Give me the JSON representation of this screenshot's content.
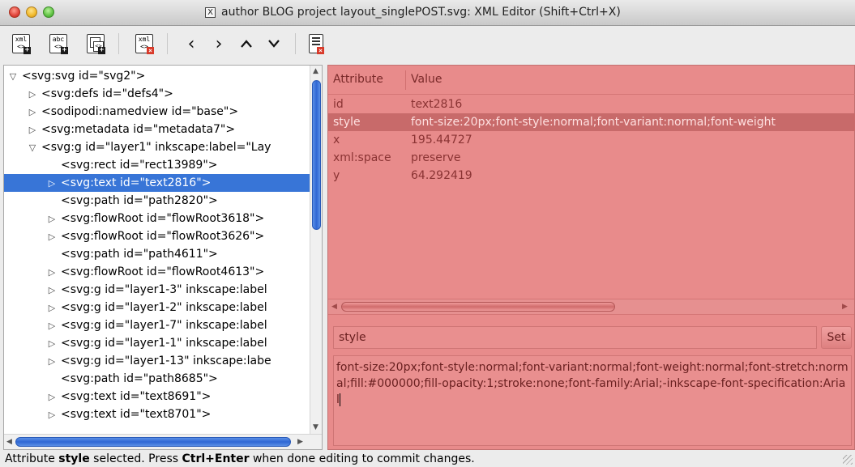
{
  "window": {
    "title": "author BLOG project layout_singlePOST.svg: XML Editor (Shift+Ctrl+X)"
  },
  "toolbar": {
    "buttons": [
      {
        "name": "new-element-node",
        "icon": "xml-new-element-icon",
        "glyph": "xml"
      },
      {
        "name": "new-text-node",
        "icon": "abc-new-text-icon",
        "glyph": "abc"
      },
      {
        "name": "duplicate-node",
        "icon": "duplicate-node-icon",
        "glyph": ""
      },
      {
        "name": "delete-node",
        "icon": "xml-delete-node-icon",
        "glyph": "xml"
      },
      {
        "name": "unindent-node",
        "icon": "chevron-left-icon",
        "glyph": "‹"
      },
      {
        "name": "indent-node",
        "icon": "chevron-right-icon",
        "glyph": "›"
      },
      {
        "name": "raise-node",
        "icon": "chevron-up-icon",
        "glyph": "⌃"
      },
      {
        "name": "lower-node",
        "icon": "chevron-down-icon",
        "glyph": "⌄"
      },
      {
        "name": "delete-attribute",
        "icon": "delete-attribute-icon",
        "glyph": ""
      }
    ]
  },
  "tree": {
    "nodes": [
      {
        "text": "<svg:svg id=\"svg2\">",
        "expander": "▽"
      },
      {
        "text": "<svg:defs id=\"defs4\">",
        "expander": "▷"
      },
      {
        "text": "<sodipodi:namedview id=\"base\">",
        "expander": "▷"
      },
      {
        "text": "<svg:metadata id=\"metadata7\">",
        "expander": "▷"
      },
      {
        "text": "<svg:g id=\"layer1\" inkscape:label=\"Lay",
        "expander": "▽"
      },
      {
        "text": "<svg:rect id=\"rect13989\">",
        "expander": ""
      },
      {
        "text": "<svg:text id=\"text2816\">",
        "expander": "▷"
      },
      {
        "text": "<svg:path id=\"path2820\">",
        "expander": ""
      },
      {
        "text": "<svg:flowRoot id=\"flowRoot3618\">",
        "expander": "▷"
      },
      {
        "text": "<svg:flowRoot id=\"flowRoot3626\">",
        "expander": "▷"
      },
      {
        "text": "<svg:path id=\"path4611\">",
        "expander": ""
      },
      {
        "text": "<svg:flowRoot id=\"flowRoot4613\">",
        "expander": "▷"
      },
      {
        "text": "<svg:g id=\"layer1-3\" inkscape:label",
        "expander": "▷"
      },
      {
        "text": "<svg:g id=\"layer1-2\" inkscape:label",
        "expander": "▷"
      },
      {
        "text": "<svg:g id=\"layer1-7\" inkscape:label",
        "expander": "▷"
      },
      {
        "text": "<svg:g id=\"layer1-1\" inkscape:label",
        "expander": "▷"
      },
      {
        "text": "<svg:g id=\"layer1-13\" inkscape:labe",
        "expander": "▷"
      },
      {
        "text": "<svg:path id=\"path8685\">",
        "expander": ""
      },
      {
        "text": "<svg:text id=\"text8691\">",
        "expander": "▷"
      },
      {
        "text": "<svg:text id=\"text8701\">",
        "expander": "▷"
      }
    ],
    "selected_index": 6
  },
  "attributes": {
    "header_attribute": "Attribute",
    "header_value": "Value",
    "rows": [
      {
        "key": "id",
        "value": "text2816"
      },
      {
        "key": "style",
        "value": "font-size:20px;font-style:normal;font-variant:normal;font-weight"
      },
      {
        "key": "x",
        "value": "195.44727"
      },
      {
        "key": "xml:space",
        "value": "preserve"
      },
      {
        "key": "y",
        "value": "64.292419"
      }
    ],
    "selected_index": 1
  },
  "editor": {
    "attribute_name": "style",
    "set_label": "Set",
    "attribute_value": "font-size:20px;font-style:normal;font-variant:normal;font-weight:normal;font-stretch:normal;fill:#000000;fill-opacity:1;stroke:none;font-family:Arial;-inkscape-font-specification:Arial"
  },
  "status": {
    "prefix": "Attribute ",
    "attr": "style",
    "middle": " selected. Press ",
    "keys": "Ctrl+Enter",
    "suffix": " when done editing to commit changes."
  },
  "colors": {
    "selection": "#3875d7",
    "attribute_panel_bg": "#e88b8b"
  }
}
